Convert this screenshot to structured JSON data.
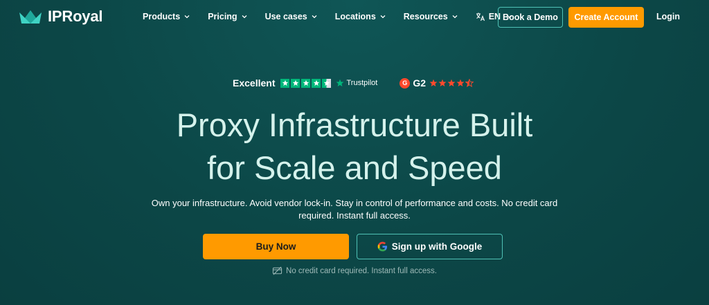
{
  "nav": {
    "logo_text": "IPRoyal",
    "menu": [
      {
        "label": "Products"
      },
      {
        "label": "Pricing"
      },
      {
        "label": "Use cases"
      },
      {
        "label": "Locations"
      },
      {
        "label": "Resources"
      }
    ],
    "language": "EN",
    "book_demo": "Book a Demo",
    "create_account": "Create Account",
    "login": "Login"
  },
  "ratings": {
    "trustpilot_label": "Excellent",
    "trustpilot_brand": "Trustpilot",
    "trustpilot_stars": 4.5,
    "g2_label": "G2",
    "g2_stars": 4.5
  },
  "hero": {
    "headline_line1": "Proxy Infrastructure Built",
    "headline_line2": "for Scale and Speed",
    "subtext_line1": "Own your infrastructure. Avoid vendor lock-in. Stay in control of performance and costs. No credit card",
    "subtext_line2": "required. Instant full access.",
    "buy_now": "Buy Now",
    "google_signup": "Sign up with Google",
    "note": "No credit card required. Instant full access."
  },
  "colors": {
    "background": "#0c4747",
    "accent_orange": "#ff9a00",
    "teal_border": "#4fc2b6",
    "headline": "#d5f2ec",
    "trustpilot_green": "#00b67a",
    "g2_red": "#ff492c"
  },
  "icons": [
    "crown-logo-icon",
    "chevron-down-icon",
    "translate-icon",
    "star-icon",
    "google-icon",
    "no-card-icon"
  ]
}
